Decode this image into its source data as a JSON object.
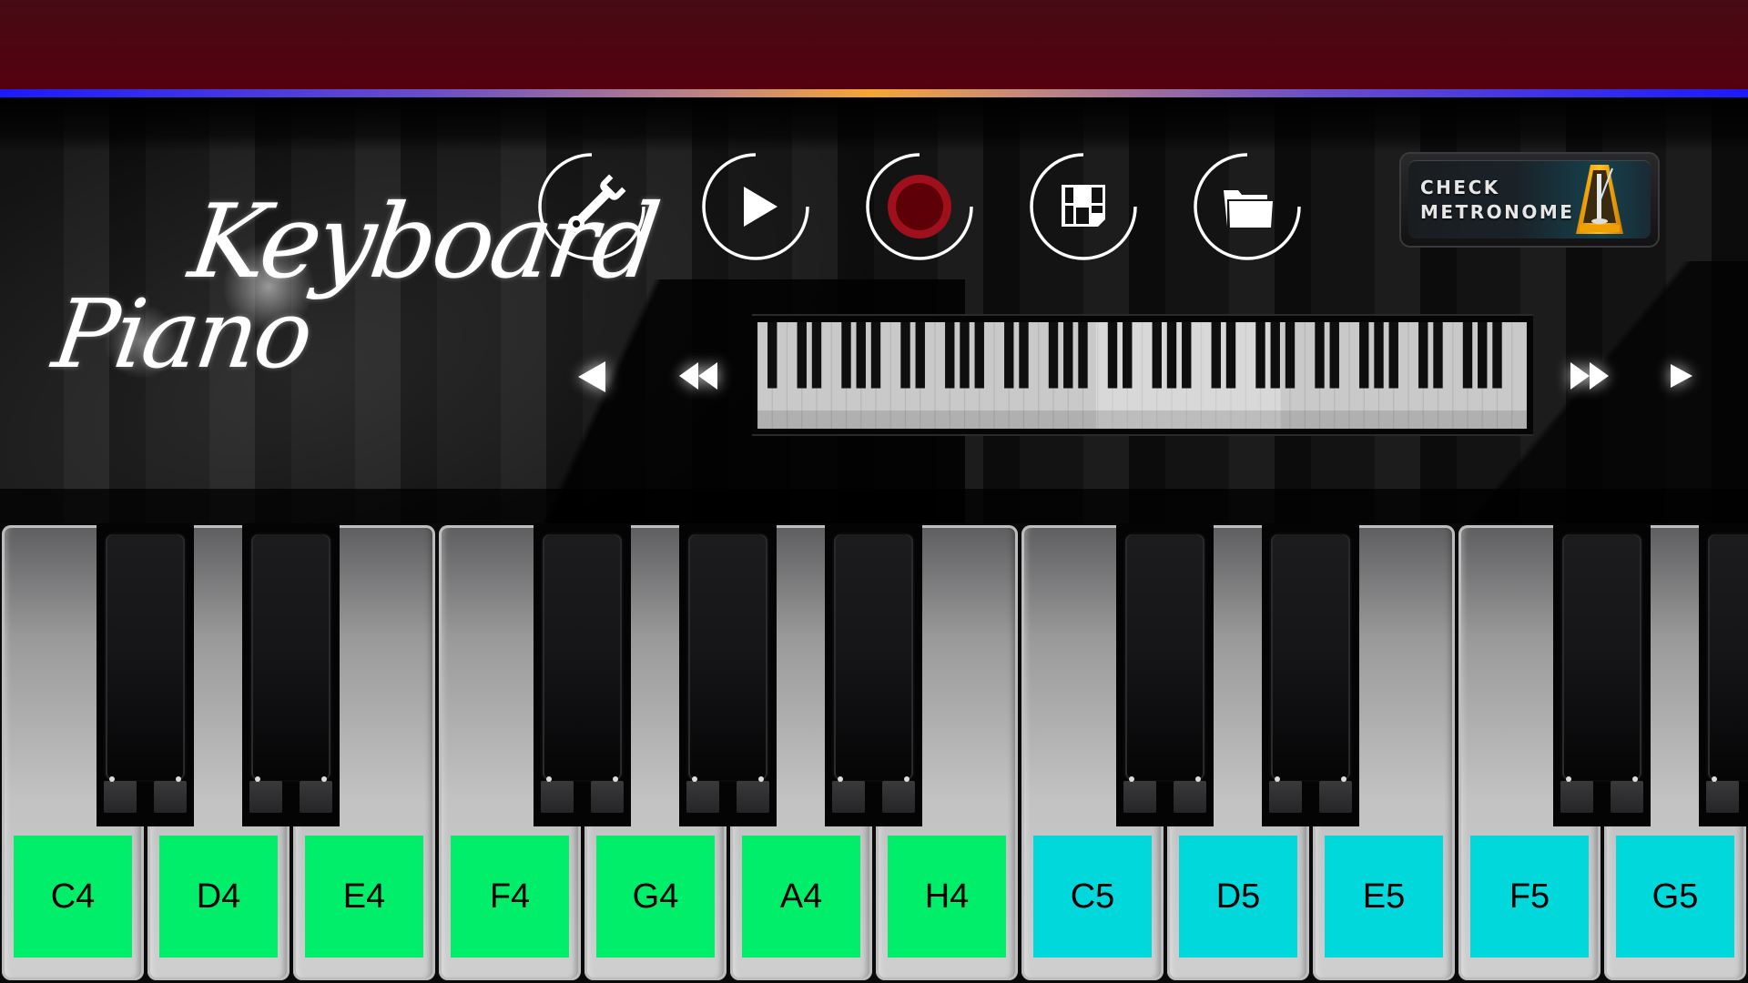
{
  "app": {
    "title_line1": "Keyboard",
    "title_line2": "Piano"
  },
  "toolbar": {
    "buttons": [
      {
        "name": "settings",
        "icon": "wrench-icon"
      },
      {
        "name": "play",
        "icon": "play-icon"
      },
      {
        "name": "record",
        "icon": "record-icon"
      },
      {
        "name": "save",
        "icon": "floppy-disk-icon"
      },
      {
        "name": "open",
        "icon": "folder-icon"
      }
    ],
    "metronome": {
      "line1": "CHECK",
      "line2": "METRONOME",
      "icon": "metronome-icon"
    }
  },
  "navigator": {
    "arrows": [
      "scroll-left-icon",
      "fast-scroll-left-icon",
      "fast-scroll-right-icon",
      "scroll-right-icon"
    ],
    "total_white_keys": 52,
    "visible_range_start_fraction": 0.44,
    "visible_range_end_fraction": 0.68
  },
  "keyboard": {
    "white_keys": [
      {
        "label": "C4",
        "color": "#00ee6a"
      },
      {
        "label": "D4",
        "color": "#00ee6a"
      },
      {
        "label": "E4",
        "color": "#00ee6a"
      },
      {
        "label": "F4",
        "color": "#00ee6a"
      },
      {
        "label": "G4",
        "color": "#00ee6a"
      },
      {
        "label": "A4",
        "color": "#00ee6a"
      },
      {
        "label": "H4",
        "color": "#00ee6a"
      },
      {
        "label": "C5",
        "color": "#00d8dc"
      },
      {
        "label": "D5",
        "color": "#00d8dc"
      },
      {
        "label": "E5",
        "color": "#00d8dc"
      },
      {
        "label": "F5",
        "color": "#00d8dc"
      },
      {
        "label": "G5",
        "color": "#00d8dc"
      }
    ],
    "black_key_after_white_index": [
      0,
      1,
      3,
      4,
      5,
      7,
      8,
      10,
      11
    ]
  },
  "colors": {
    "octave4_label": "#00ee6a",
    "octave5_label": "#00d8dc",
    "record_outer": "#a0101c",
    "record_inner": "#5e0008",
    "topbar": "#4e0510"
  }
}
